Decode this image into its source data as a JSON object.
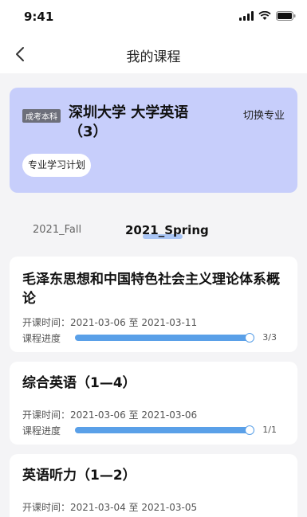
{
  "status_bar": {
    "time": "9:41"
  },
  "nav": {
    "title": "我的课程"
  },
  "header": {
    "badge": "成考本科",
    "course_title": "深圳大学 大学英语（3）",
    "switch_label": "切换专业",
    "plan_label": "专业学习计划",
    "card_color": "#c7cefb"
  },
  "terms": {
    "fall": "2021_Fall",
    "spring": "2021_Spring",
    "active": "2021_Spring"
  },
  "courses": [
    {
      "title": "毛泽东思想和中国特色社会主义理论体系概论",
      "dates": "开课时间：2021-03-06 至 2021-03-11",
      "progress_label": "课程进度",
      "progress": 1.0,
      "count": "3/3"
    },
    {
      "title": "综合英语（1—4）",
      "dates": "开课时间：2021-03-06 至 2021-03-06",
      "progress_label": "课程进度",
      "progress": 1.0,
      "count": "1/1"
    },
    {
      "title": "英语听力（1—2）",
      "dates": "开课时间：2021-03-04 至 2021-03-05"
    }
  ],
  "colors": {
    "accent": "#5aa0e8",
    "background": "#f4f4f6"
  }
}
